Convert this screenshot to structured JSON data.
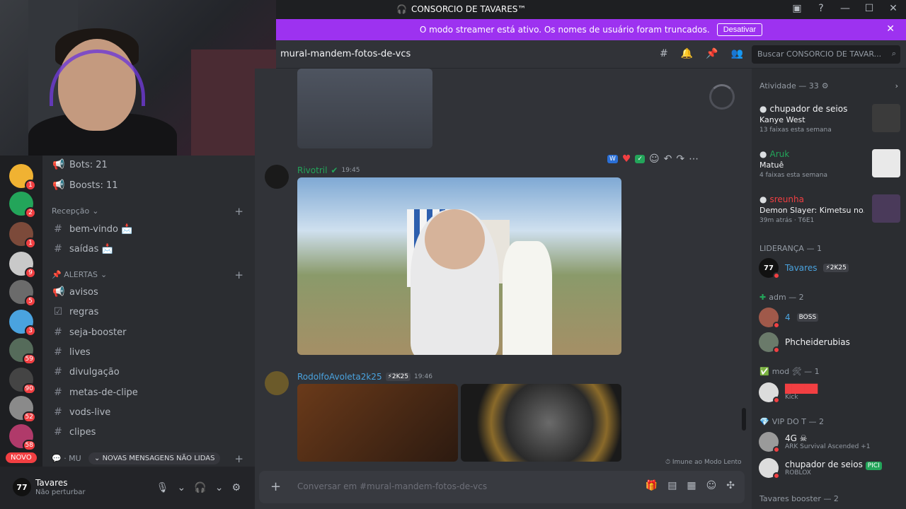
{
  "window": {
    "title": "CONSORCIO DE TAVARES™",
    "controls": [
      "▣",
      "?",
      "—",
      "☐",
      "✕"
    ]
  },
  "banner": {
    "text": "O modo streamer está ativo. Os nomes de usuário foram truncados.",
    "button": "Desativar"
  },
  "channel_header": {
    "name": "mural-mandem-fotos-de-vcs"
  },
  "search": {
    "placeholder": "Buscar CONSORCIO DE TAVAR..."
  },
  "servers": [
    {
      "badge": "1",
      "color": "#f0b232"
    },
    {
      "badge": "2",
      "color": "#23a55a"
    },
    {
      "badge": "1",
      "color": "#7c4a3a"
    },
    {
      "badge": "9",
      "color": "#c9c9c9"
    },
    {
      "badge": "5",
      "color": "#6b6b6b"
    },
    {
      "badge": "3",
      "color": "#4aa3df"
    },
    {
      "badge": "59",
      "color": "#556b5a"
    },
    {
      "badge": "90",
      "color": "#444"
    },
    {
      "badge": "52",
      "color": "#8a8a8a"
    },
    {
      "badge": "58",
      "color": "#b03a6a"
    }
  ],
  "novo_label": "NOVO",
  "channels": {
    "stats": [
      {
        "icon": "📢",
        "label": "Bots: 21"
      },
      {
        "icon": "📢",
        "label": "Boosts: 11"
      }
    ],
    "cat1": "Recepção",
    "cat1_items": [
      {
        "icon": "#",
        "label": "bem-vindo 📩"
      },
      {
        "icon": "#",
        "label": "saídas 📩"
      }
    ],
    "cat2": "📌 ALERTAS",
    "cat2_items": [
      {
        "icon": "📢",
        "label": "avisos"
      },
      {
        "icon": "☑",
        "label": "regras"
      },
      {
        "icon": "#",
        "label": "seja-booster"
      },
      {
        "icon": "#",
        "label": "lives"
      },
      {
        "icon": "#",
        "label": "divulgação"
      },
      {
        "icon": "#",
        "label": "metas-de-clipe"
      },
      {
        "icon": "#",
        "label": "vods-live"
      },
      {
        "icon": "#",
        "label": "clipes"
      }
    ],
    "cat3": "💬 · MU",
    "unread": "NOVAS MENSAGENS NÃO LIDAS"
  },
  "user": {
    "name": "Tavares",
    "status": "Não perturbar",
    "avatar_text": "77"
  },
  "messages": {
    "m1": {
      "author": "Rivotril",
      "time": "19:45"
    },
    "m2": {
      "author": "RodolfoAvoleta2k25",
      "tag": "⚡2K25",
      "time": "19:46"
    }
  },
  "reactions": [
    "W",
    "♥",
    "✓"
  ],
  "immune": "Imune ao Modo Lento",
  "composer": {
    "placeholder": "Conversar em #mural-mandem-fotos-de-vcs"
  },
  "members": {
    "activity_header": "Atividade — 33",
    "activities": [
      {
        "user": "chupador de seios",
        "title": "Kanye West",
        "meta": "13 faixas esta semana",
        "color": "#f2f3f5"
      },
      {
        "user": "Aruk",
        "title": "Matuê",
        "meta": "4 faixas esta semana",
        "color": "#23a55a"
      },
      {
        "user": "sreunha",
        "title": "Demon Slayer: Kimetsu no...",
        "meta": "39m atrás  ·  T6E1",
        "color": "#f23f42"
      }
    ],
    "lideranca": "LIDERANÇA — 1",
    "lider": {
      "name": "Tavares",
      "tag": "⚡2K25",
      "avatar_text": "77"
    },
    "adm": "adm — 2",
    "adm_members": [
      {
        "name": "4",
        "tag": "BOSS"
      },
      {
        "name": "Phcheiderubias"
      }
    ],
    "mod": "mod 🛠 — 1",
    "mod_member": {
      "name": "█████",
      "sub": "Kick"
    },
    "vip": "VIP DO T — 2",
    "vip_members": [
      {
        "name": "4G ☠",
        "sub": "ARK Survival Ascended +1"
      },
      {
        "name": "chupador de seios",
        "tag": "PICI",
        "sub": "ROBLOX"
      }
    ],
    "booster": "Tavares booster — 2"
  }
}
